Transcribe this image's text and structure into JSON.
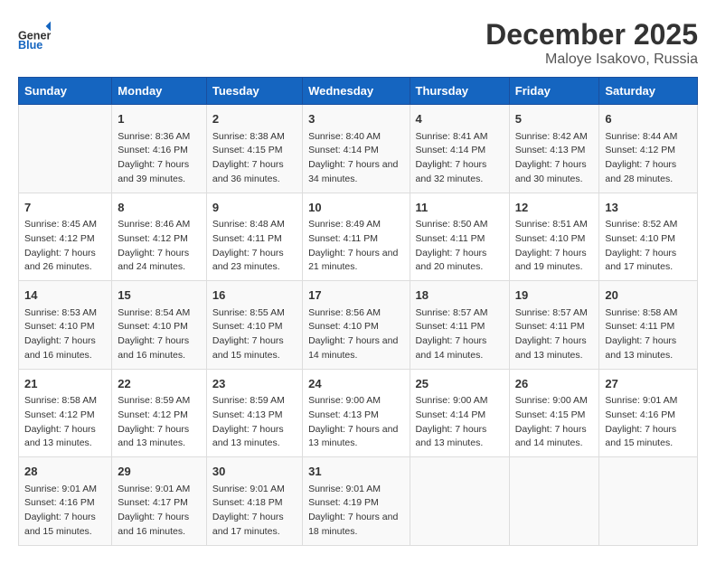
{
  "header": {
    "logo_general": "General",
    "logo_blue": "Blue",
    "month": "December 2025",
    "location": "Maloye Isakovo, Russia"
  },
  "days_of_week": [
    "Sunday",
    "Monday",
    "Tuesday",
    "Wednesday",
    "Thursday",
    "Friday",
    "Saturday"
  ],
  "weeks": [
    [
      {
        "day": "",
        "sunrise": "",
        "sunset": "",
        "daylight": ""
      },
      {
        "day": "1",
        "sunrise": "Sunrise: 8:36 AM",
        "sunset": "Sunset: 4:16 PM",
        "daylight": "Daylight: 7 hours and 39 minutes."
      },
      {
        "day": "2",
        "sunrise": "Sunrise: 8:38 AM",
        "sunset": "Sunset: 4:15 PM",
        "daylight": "Daylight: 7 hours and 36 minutes."
      },
      {
        "day": "3",
        "sunrise": "Sunrise: 8:40 AM",
        "sunset": "Sunset: 4:14 PM",
        "daylight": "Daylight: 7 hours and 34 minutes."
      },
      {
        "day": "4",
        "sunrise": "Sunrise: 8:41 AM",
        "sunset": "Sunset: 4:14 PM",
        "daylight": "Daylight: 7 hours and 32 minutes."
      },
      {
        "day": "5",
        "sunrise": "Sunrise: 8:42 AM",
        "sunset": "Sunset: 4:13 PM",
        "daylight": "Daylight: 7 hours and 30 minutes."
      },
      {
        "day": "6",
        "sunrise": "Sunrise: 8:44 AM",
        "sunset": "Sunset: 4:12 PM",
        "daylight": "Daylight: 7 hours and 28 minutes."
      }
    ],
    [
      {
        "day": "7",
        "sunrise": "Sunrise: 8:45 AM",
        "sunset": "Sunset: 4:12 PM",
        "daylight": "Daylight: 7 hours and 26 minutes."
      },
      {
        "day": "8",
        "sunrise": "Sunrise: 8:46 AM",
        "sunset": "Sunset: 4:12 PM",
        "daylight": "Daylight: 7 hours and 24 minutes."
      },
      {
        "day": "9",
        "sunrise": "Sunrise: 8:48 AM",
        "sunset": "Sunset: 4:11 PM",
        "daylight": "Daylight: 7 hours and 23 minutes."
      },
      {
        "day": "10",
        "sunrise": "Sunrise: 8:49 AM",
        "sunset": "Sunset: 4:11 PM",
        "daylight": "Daylight: 7 hours and 21 minutes."
      },
      {
        "day": "11",
        "sunrise": "Sunrise: 8:50 AM",
        "sunset": "Sunset: 4:11 PM",
        "daylight": "Daylight: 7 hours and 20 minutes."
      },
      {
        "day": "12",
        "sunrise": "Sunrise: 8:51 AM",
        "sunset": "Sunset: 4:10 PM",
        "daylight": "Daylight: 7 hours and 19 minutes."
      },
      {
        "day": "13",
        "sunrise": "Sunrise: 8:52 AM",
        "sunset": "Sunset: 4:10 PM",
        "daylight": "Daylight: 7 hours and 17 minutes."
      }
    ],
    [
      {
        "day": "14",
        "sunrise": "Sunrise: 8:53 AM",
        "sunset": "Sunset: 4:10 PM",
        "daylight": "Daylight: 7 hours and 16 minutes."
      },
      {
        "day": "15",
        "sunrise": "Sunrise: 8:54 AM",
        "sunset": "Sunset: 4:10 PM",
        "daylight": "Daylight: 7 hours and 16 minutes."
      },
      {
        "day": "16",
        "sunrise": "Sunrise: 8:55 AM",
        "sunset": "Sunset: 4:10 PM",
        "daylight": "Daylight: 7 hours and 15 minutes."
      },
      {
        "day": "17",
        "sunrise": "Sunrise: 8:56 AM",
        "sunset": "Sunset: 4:10 PM",
        "daylight": "Daylight: 7 hours and 14 minutes."
      },
      {
        "day": "18",
        "sunrise": "Sunrise: 8:57 AM",
        "sunset": "Sunset: 4:11 PM",
        "daylight": "Daylight: 7 hours and 14 minutes."
      },
      {
        "day": "19",
        "sunrise": "Sunrise: 8:57 AM",
        "sunset": "Sunset: 4:11 PM",
        "daylight": "Daylight: 7 hours and 13 minutes."
      },
      {
        "day": "20",
        "sunrise": "Sunrise: 8:58 AM",
        "sunset": "Sunset: 4:11 PM",
        "daylight": "Daylight: 7 hours and 13 minutes."
      }
    ],
    [
      {
        "day": "21",
        "sunrise": "Sunrise: 8:58 AM",
        "sunset": "Sunset: 4:12 PM",
        "daylight": "Daylight: 7 hours and 13 minutes."
      },
      {
        "day": "22",
        "sunrise": "Sunrise: 8:59 AM",
        "sunset": "Sunset: 4:12 PM",
        "daylight": "Daylight: 7 hours and 13 minutes."
      },
      {
        "day": "23",
        "sunrise": "Sunrise: 8:59 AM",
        "sunset": "Sunset: 4:13 PM",
        "daylight": "Daylight: 7 hours and 13 minutes."
      },
      {
        "day": "24",
        "sunrise": "Sunrise: 9:00 AM",
        "sunset": "Sunset: 4:13 PM",
        "daylight": "Daylight: 7 hours and 13 minutes."
      },
      {
        "day": "25",
        "sunrise": "Sunrise: 9:00 AM",
        "sunset": "Sunset: 4:14 PM",
        "daylight": "Daylight: 7 hours and 13 minutes."
      },
      {
        "day": "26",
        "sunrise": "Sunrise: 9:00 AM",
        "sunset": "Sunset: 4:15 PM",
        "daylight": "Daylight: 7 hours and 14 minutes."
      },
      {
        "day": "27",
        "sunrise": "Sunrise: 9:01 AM",
        "sunset": "Sunset: 4:16 PM",
        "daylight": "Daylight: 7 hours and 15 minutes."
      }
    ],
    [
      {
        "day": "28",
        "sunrise": "Sunrise: 9:01 AM",
        "sunset": "Sunset: 4:16 PM",
        "daylight": "Daylight: 7 hours and 15 minutes."
      },
      {
        "day": "29",
        "sunrise": "Sunrise: 9:01 AM",
        "sunset": "Sunset: 4:17 PM",
        "daylight": "Daylight: 7 hours and 16 minutes."
      },
      {
        "day": "30",
        "sunrise": "Sunrise: 9:01 AM",
        "sunset": "Sunset: 4:18 PM",
        "daylight": "Daylight: 7 hours and 17 minutes."
      },
      {
        "day": "31",
        "sunrise": "Sunrise: 9:01 AM",
        "sunset": "Sunset: 4:19 PM",
        "daylight": "Daylight: 7 hours and 18 minutes."
      },
      {
        "day": "",
        "sunrise": "",
        "sunset": "",
        "daylight": ""
      },
      {
        "day": "",
        "sunrise": "",
        "sunset": "",
        "daylight": ""
      },
      {
        "day": "",
        "sunrise": "",
        "sunset": "",
        "daylight": ""
      }
    ]
  ]
}
